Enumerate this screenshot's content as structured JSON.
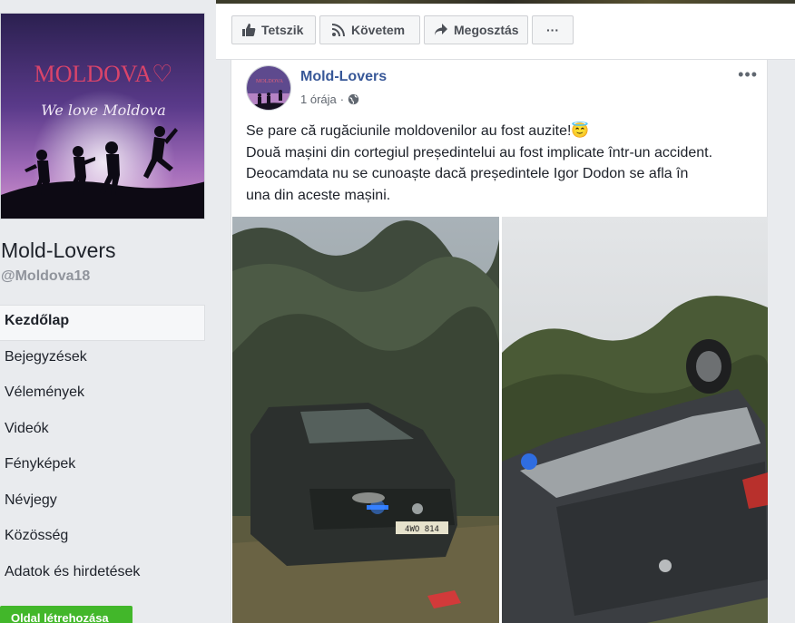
{
  "page": {
    "name": "Mold-Lovers",
    "handle": "@Moldova18",
    "cover": {
      "title": "MOLDOVA♡",
      "subtitle": "We love Moldova"
    },
    "create_page_label": "Oldal létrehozása"
  },
  "nav": {
    "items": [
      {
        "label": "Kezdőlap",
        "active": true
      },
      {
        "label": "Bejegyzések"
      },
      {
        "label": "Vélemények"
      },
      {
        "label": "Videók"
      },
      {
        "label": "Fényképek"
      },
      {
        "label": "Névjegy"
      },
      {
        "label": "Közösség"
      },
      {
        "label": "Adatok és hirdetések"
      }
    ]
  },
  "actions": {
    "like": "Tetszik",
    "follow": "Követem",
    "share": "Megosztás",
    "more": "···"
  },
  "post": {
    "author": "Mold-Lovers",
    "time": "1 órája",
    "separator": "·",
    "more": "•••",
    "lines": [
      "Se pare că rugăciunile moldovenilor au fost auzite!😇",
      "Două mașini din cortegiul președintelui au fost implicate într-un accident.",
      "Deocamdata nu se cunoaște dacă președintele Igor Dodon se afla în",
      "una din aceste mașini."
    ],
    "photos": {
      "left_plate": "4WO 814"
    }
  },
  "colors": {
    "link": "#385898",
    "create_button": "#42b72a",
    "background": "#e9ebee"
  }
}
